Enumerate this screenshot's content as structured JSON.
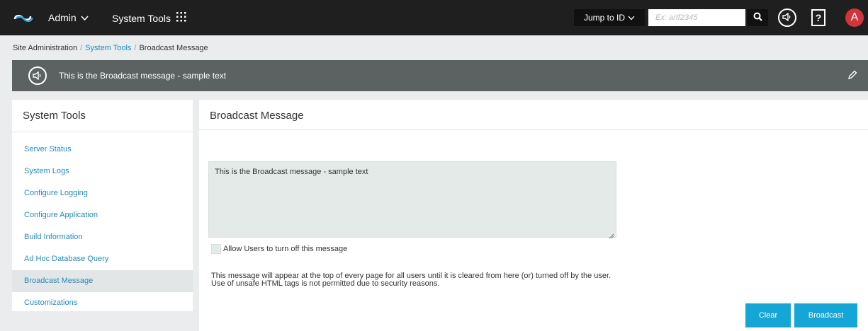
{
  "topbar": {
    "admin_label": "Admin",
    "system_tools_label": "System Tools",
    "jump_to_id_label": "Jump to ID",
    "search_placeholder": "Ex: artf2345",
    "avatar_letter": "A",
    "help_label": "?"
  },
  "breadcrumb": {
    "site_admin": "Site Administration",
    "system_tools": "System Tools",
    "current": "Broadcast Message",
    "separator": "/"
  },
  "banner": {
    "text": "This is the Broadcast message - sample text"
  },
  "sidebar": {
    "title": "System Tools",
    "items": [
      {
        "label": "Server Status"
      },
      {
        "label": "System Logs"
      },
      {
        "label": "Configure Logging"
      },
      {
        "label": "Configure Application"
      },
      {
        "label": "Build Information"
      },
      {
        "label": "Ad Hoc Database Query"
      },
      {
        "label": "Broadcast Message"
      },
      {
        "label": "Customizations"
      }
    ],
    "active_index": 6
  },
  "main": {
    "title": "Broadcast Message",
    "message_value": "This is the Broadcast message - sample text",
    "checkbox_label": "Allow Users to turn off this message",
    "checkbox_checked": false,
    "info_line1": "This message will appear at the top of every page for all users until it is cleared from here (or) turned off by the user.",
    "info_line2": "Use of unsafe HTML tags is not permitted due to security reasons.",
    "clear_label": "Clear",
    "broadcast_label": "Broadcast"
  },
  "colors": {
    "topbar_bg": "#1f1f1f",
    "banner_bg": "#5c6162",
    "accent": "#13a6d7",
    "link": "#1f8dbf",
    "avatar": "#d0343c"
  }
}
